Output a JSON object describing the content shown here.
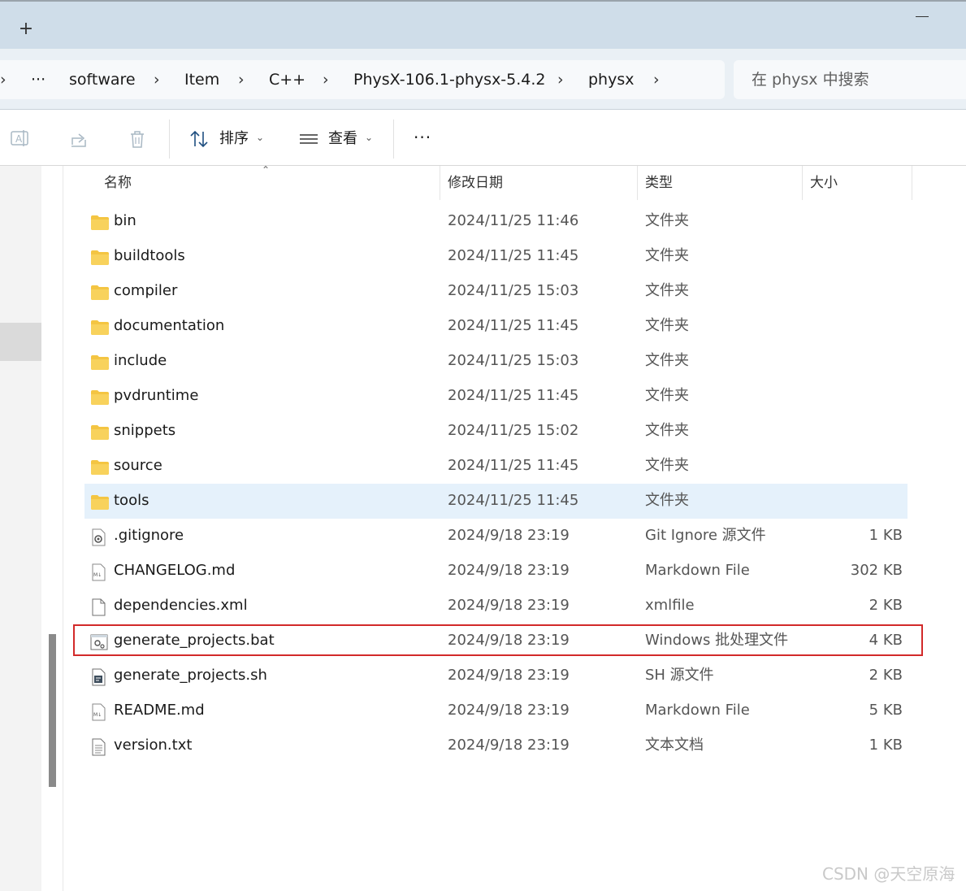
{
  "window": {
    "new_tab_glyph": "+"
  },
  "breadcrumb": {
    "more": "···",
    "items": [
      "software",
      "Item",
      "C++",
      "PhysX-106.1-physx-5.4.2",
      "physx"
    ]
  },
  "search": {
    "placeholder": "在 physx 中搜索"
  },
  "toolbar": {
    "sort_label": "排序",
    "view_label": "查看",
    "more": "···"
  },
  "columns": {
    "name": "名称",
    "date": "修改日期",
    "type": "类型",
    "size": "大小"
  },
  "files": [
    {
      "name": "bin",
      "date": "2024/11/25 11:46",
      "type": "文件夹",
      "size": "",
      "icon": "folder-icon"
    },
    {
      "name": "buildtools",
      "date": "2024/11/25 11:45",
      "type": "文件夹",
      "size": "",
      "icon": "folder-icon"
    },
    {
      "name": "compiler",
      "date": "2024/11/25 15:03",
      "type": "文件夹",
      "size": "",
      "icon": "folder-icon"
    },
    {
      "name": "documentation",
      "date": "2024/11/25 11:45",
      "type": "文件夹",
      "size": "",
      "icon": "folder-icon"
    },
    {
      "name": "include",
      "date": "2024/11/25 15:03",
      "type": "文件夹",
      "size": "",
      "icon": "folder-icon"
    },
    {
      "name": "pvdruntime",
      "date": "2024/11/25 11:45",
      "type": "文件夹",
      "size": "",
      "icon": "folder-icon"
    },
    {
      "name": "snippets",
      "date": "2024/11/25 15:02",
      "type": "文件夹",
      "size": "",
      "icon": "folder-icon"
    },
    {
      "name": "source",
      "date": "2024/11/25 11:45",
      "type": "文件夹",
      "size": "",
      "icon": "folder-icon"
    },
    {
      "name": "tools",
      "date": "2024/11/25 11:45",
      "type": "文件夹",
      "size": "",
      "icon": "folder-icon",
      "selected": true
    },
    {
      "name": ".gitignore",
      "date": "2024/9/18 23:19",
      "type": "Git Ignore 源文件",
      "size": "1 KB",
      "icon": "gear-file-icon"
    },
    {
      "name": "CHANGELOG.md",
      "date": "2024/9/18 23:19",
      "type": "Markdown File",
      "size": "302 KB",
      "icon": "markdown-file-icon"
    },
    {
      "name": "dependencies.xml",
      "date": "2024/9/18 23:19",
      "type": "xmlfile",
      "size": "2 KB",
      "icon": "blank-file-icon"
    },
    {
      "name": "generate_projects.bat",
      "date": "2024/9/18 23:19",
      "type": "Windows 批处理文件",
      "size": "4 KB",
      "icon": "batch-file-icon",
      "highlighted": true
    },
    {
      "name": "generate_projects.sh",
      "date": "2024/9/18 23:19",
      "type": "SH 源文件",
      "size": "2 KB",
      "icon": "script-file-icon"
    },
    {
      "name": "README.md",
      "date": "2024/9/18 23:19",
      "type": "Markdown File",
      "size": "5 KB",
      "icon": "markdown-file-icon"
    },
    {
      "name": "version.txt",
      "date": "2024/9/18 23:19",
      "type": "文本文档",
      "size": "1 KB",
      "icon": "text-file-icon"
    }
  ],
  "colors": {
    "accent_highlight": "#d22a2a",
    "selected_row": "#e5f1fb",
    "folder": "#f4c542"
  },
  "watermark": "CSDN @天空原海"
}
